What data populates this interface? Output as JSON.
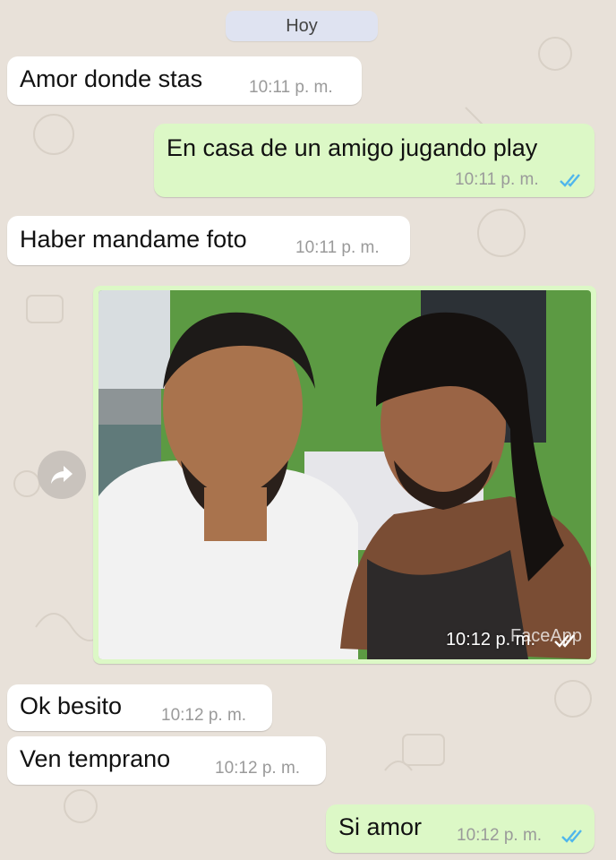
{
  "header": {
    "date_label": "Hoy"
  },
  "messages": [
    {
      "direction": "in",
      "text": "Amor donde stas",
      "time": "10:11 p. m."
    },
    {
      "direction": "out",
      "text": "En casa de un amigo jugando play",
      "time": "10:11 p. m.",
      "status": "read"
    },
    {
      "direction": "in",
      "text": "Haber mandame foto",
      "time": "10:11 p. m."
    },
    {
      "direction": "out",
      "type": "image",
      "description": "selfie of two men",
      "time": "10:12 p. m.",
      "watermark": "FaceApp",
      "status": "read"
    },
    {
      "direction": "in",
      "text": "Ok besito",
      "time": "10:12 p. m."
    },
    {
      "direction": "in",
      "text": "Ven temprano",
      "time": "10:12 p. m."
    },
    {
      "direction": "out",
      "text": "Si amor",
      "time": "10:12 p. m.",
      "status": "read"
    }
  ],
  "colors": {
    "background": "#e8e1d9",
    "incoming_bubble": "#ffffff",
    "outgoing_bubble": "#dcf8c6",
    "read_ticks": "#4fb6ec"
  },
  "icons": {
    "forward": "share-arrow-icon",
    "read": "double-check-icon"
  }
}
